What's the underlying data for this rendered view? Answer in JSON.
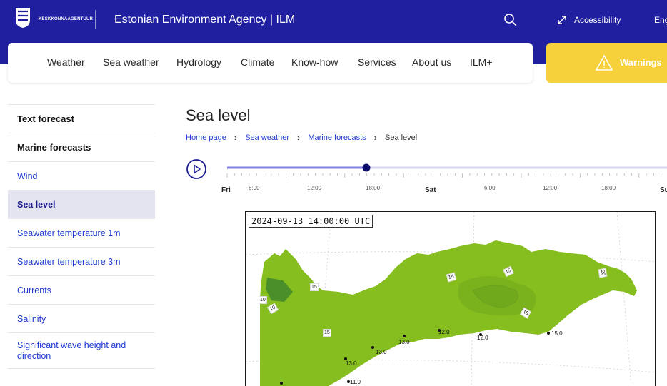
{
  "header": {
    "agency_small": "KESKKONNAAGENTUUR",
    "title": "Estonian Environment Agency | ILM",
    "accessibility": "Accessibility",
    "language": "Eng"
  },
  "nav": {
    "items": [
      "Weather",
      "Sea weather",
      "Hydrology",
      "Climate",
      "Know-how",
      "Services",
      "About us",
      "ILM+"
    ],
    "warning": "Warnings"
  },
  "sidebar": {
    "items": [
      {
        "label": "Text forecast"
      },
      {
        "label": "Marine forecasts"
      },
      {
        "label": "Wind"
      },
      {
        "label": "Sea level"
      },
      {
        "label": "Seawater temperature 1m"
      },
      {
        "label": "Seawater temperature 3m"
      },
      {
        "label": "Currents"
      },
      {
        "label": "Salinity"
      },
      {
        "label": "Significant wave height and direction"
      }
    ],
    "active": "Sea level"
  },
  "page": {
    "title": "Sea level",
    "breadcrumb": [
      "Home page",
      "Sea weather",
      "Marine forecasts",
      "Sea level"
    ]
  },
  "timeline": {
    "progress": 0.39,
    "days": [
      "Fri",
      "Sat",
      "Su"
    ],
    "times": [
      "6:00",
      "12:00",
      "18:00",
      "6:00",
      "12:00",
      "18:00"
    ]
  },
  "map": {
    "timestamp": "2024-09-13 14:00:00 UTC",
    "contours": [
      "10",
      "10",
      "15",
      "15",
      "15",
      "15",
      "20",
      "15"
    ],
    "stations": [
      "12.0",
      "12.0",
      "15.0",
      "13.0",
      "13.0",
      "13.0",
      "11.0"
    ],
    "colors": {
      "sea": "#86bd1f",
      "sea_dark": "#6fa61c",
      "sea_bay": "#4b8f2a"
    }
  },
  "colors": {
    "brand": "#1f1fa0",
    "warning": "#f6d13c",
    "link": "#1f3ad0",
    "active_bg": "#e4e4f1"
  }
}
